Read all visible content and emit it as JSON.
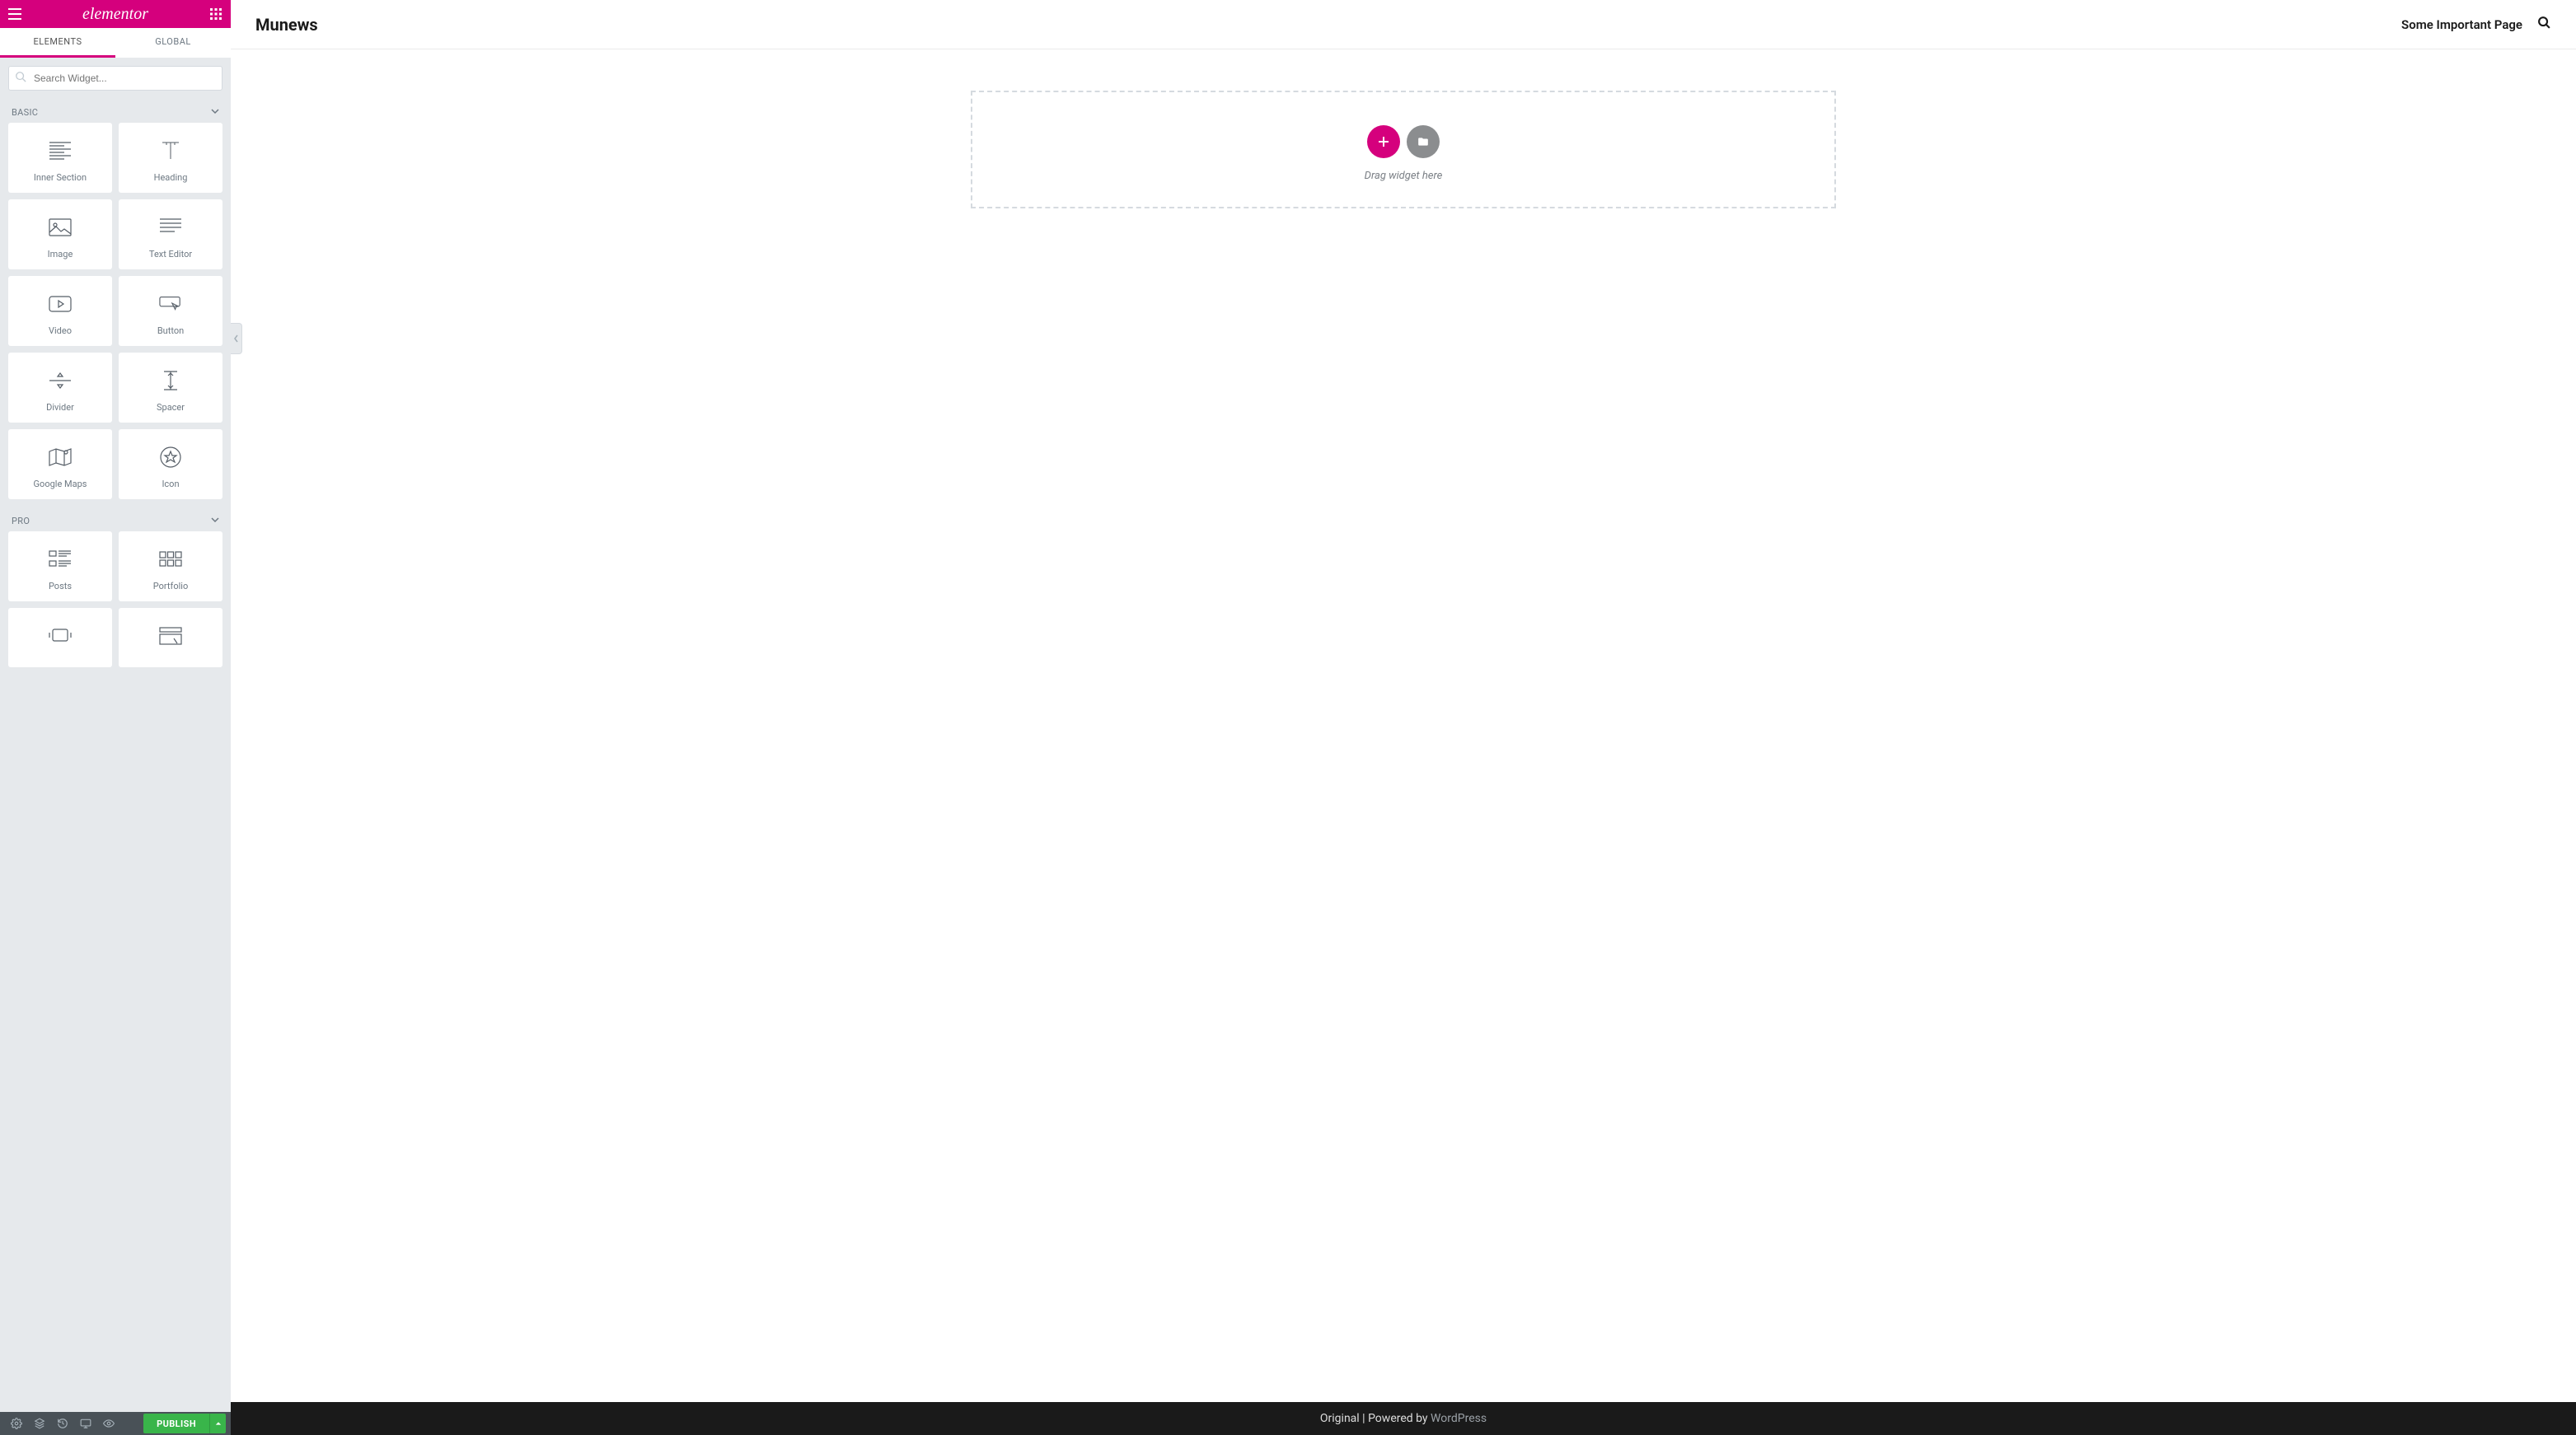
{
  "brand": "elementor",
  "tabs": {
    "elements": "ELEMENTS",
    "global": "GLOBAL"
  },
  "search_placeholder": "Search Widget...",
  "sections": {
    "basic": {
      "title": "BASIC",
      "widgets": [
        {
          "id": "inner-section",
          "label": "Inner Section"
        },
        {
          "id": "heading",
          "label": "Heading"
        },
        {
          "id": "image",
          "label": "Image"
        },
        {
          "id": "text-editor",
          "label": "Text Editor"
        },
        {
          "id": "video",
          "label": "Video"
        },
        {
          "id": "button",
          "label": "Button"
        },
        {
          "id": "divider",
          "label": "Divider"
        },
        {
          "id": "spacer",
          "label": "Spacer"
        },
        {
          "id": "google-maps",
          "label": "Google Maps"
        },
        {
          "id": "icon",
          "label": "Icon"
        }
      ]
    },
    "pro": {
      "title": "PRO",
      "widgets": [
        {
          "id": "posts",
          "label": "Posts"
        },
        {
          "id": "portfolio",
          "label": "Portfolio"
        },
        {
          "id": "slides",
          "label": ""
        },
        {
          "id": "form",
          "label": ""
        }
      ]
    }
  },
  "footer": {
    "publish": "PUBLISH"
  },
  "canvas": {
    "site_title": "Munews",
    "nav_link": "Some Important Page",
    "drop_text": "Drag widget here",
    "footer_text": "Original | Powered by ",
    "footer_link": "WordPress"
  }
}
